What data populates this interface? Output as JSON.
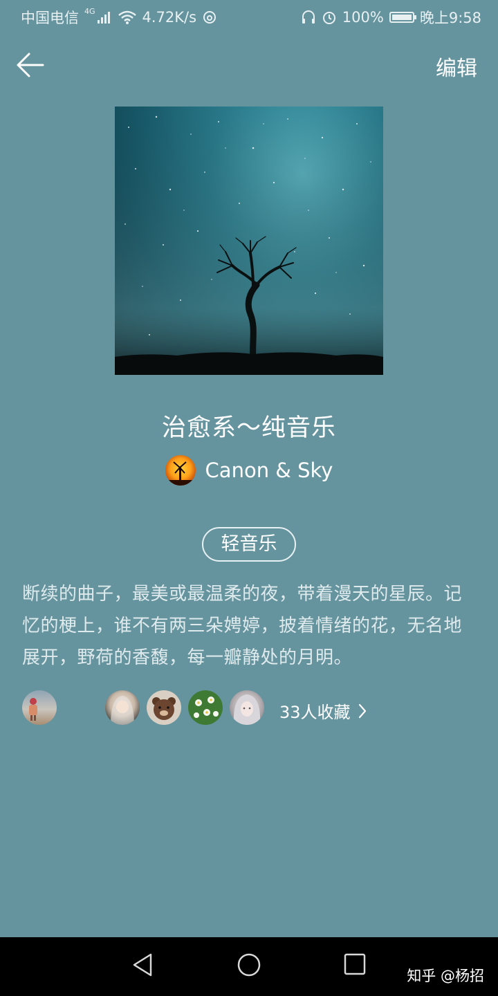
{
  "status_bar": {
    "carrier": "中国电信",
    "network": "4G",
    "speed": "4.72K/s",
    "battery": "100%",
    "time": "晚上9:58"
  },
  "header": {
    "back_icon": "arrow-left-icon",
    "edit_label": "编辑"
  },
  "playlist": {
    "title": "治愈系～纯音乐",
    "author": "Canon & Sky",
    "tag": "轻音乐",
    "description": "断续的曲子，最美或最温柔的夜，带着漫天的星辰。记忆的梗上，谁不有两三朵娉婷，披着情绪的花，无名地展开，野荷的香馥，每一瓣静处的月明。",
    "collect_text": "33人收藏",
    "collector_avatars": [
      "child-on-beach",
      "hooded-girl",
      "bear",
      "white-flowers",
      "silver-hair-girl"
    ]
  },
  "nav_bar": {
    "back": "triangle-back-icon",
    "home": "circle-home-icon",
    "recent": "square-recent-icon",
    "watermark": "知乎 @杨招"
  },
  "colors": {
    "background": "#65949f",
    "nav_background": "#000000",
    "text": "#ffffff"
  }
}
